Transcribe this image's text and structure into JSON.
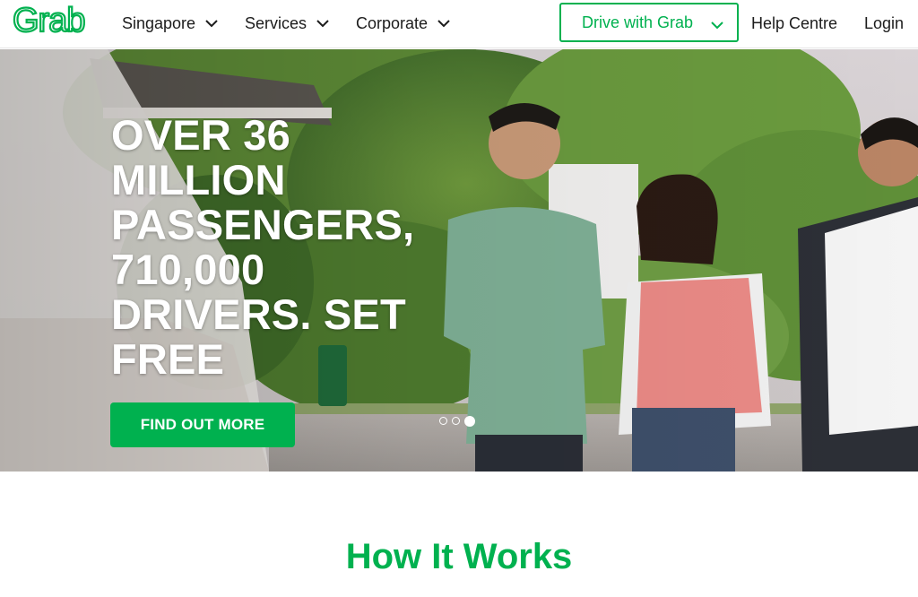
{
  "header": {
    "logo_text": "Grab",
    "nav": [
      {
        "label": "Singapore"
      },
      {
        "label": "Services"
      },
      {
        "label": "Corporate"
      }
    ],
    "drive_button": "Drive with Grab",
    "help_link": "Help Centre",
    "login_link": "Login"
  },
  "hero": {
    "title": "OVER 36 MILLION PASSENGERS, 710,000 DRIVERS. SET FREE",
    "cta": "FIND OUT MORE",
    "carousel": {
      "total_slides": 3,
      "active_slide": 3
    }
  },
  "how_it_works": {
    "title": "How It Works"
  },
  "colors": {
    "brand_green": "#00b14f",
    "text_dark": "#1c1c1c"
  }
}
